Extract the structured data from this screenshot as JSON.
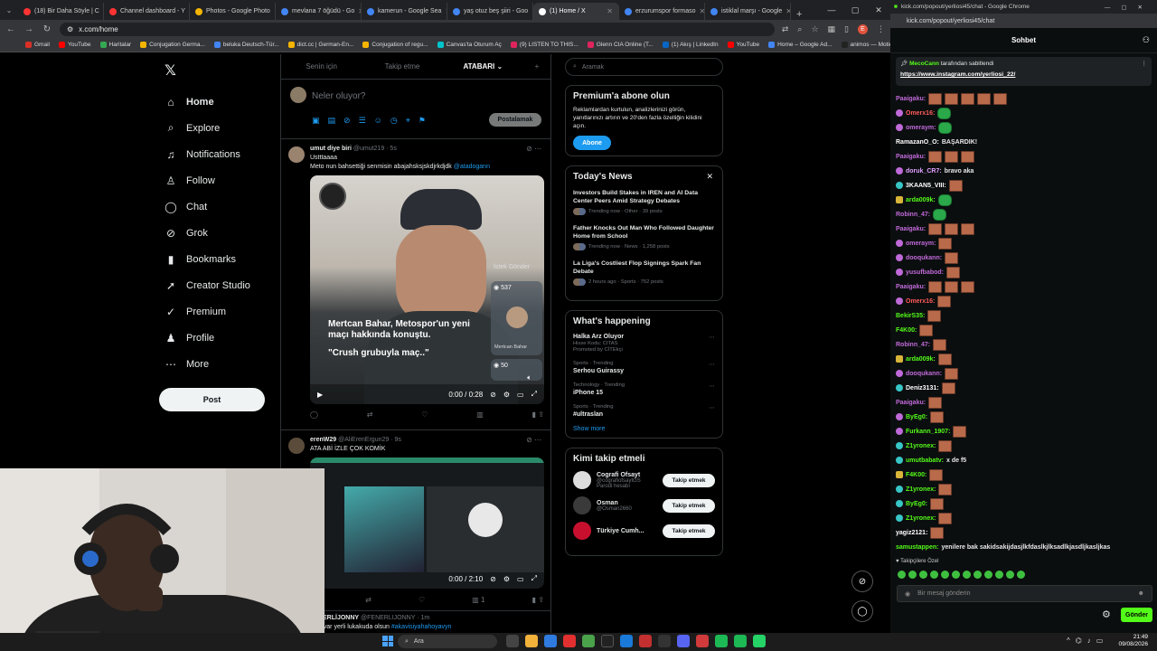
{
  "browser": {
    "tabs": [
      {
        "label": "(18) Bir Daha Söyle | C",
        "color": "#ff3333"
      },
      {
        "label": "Channel dashboard - Y",
        "color": "#ff3333"
      },
      {
        "label": "Photos - Google Photo",
        "color": "#f4b400"
      },
      {
        "label": "mevlana 7 öğüdü - Go",
        "color": "#4285f4"
      },
      {
        "label": "kamerun - Google Sea",
        "color": "#4285f4"
      },
      {
        "label": "yaş otuz beş şiiri - Goo",
        "color": "#4285f4"
      },
      {
        "label": "(1) Home / X",
        "color": "#ffffff"
      },
      {
        "label": "erzurumspor formaso",
        "color": "#4285f4"
      },
      {
        "label": "istiklal marşı - Google",
        "color": "#4285f4"
      }
    ],
    "url": "x.com/home",
    "bookmarks": [
      "Gmail",
      "YouTube",
      "Haritalar",
      "Conjugation Germa...",
      "beluka Deutsch-Tür...",
      "dict.cc | German-En...",
      "Conjugation of regu...",
      "Canvas'ta Oturum Aç",
      "(9) LISTEN TO THIS...",
      "Glenn CIA Online (T...",
      "(1) Akış | LinkedIn",
      "YouTube",
      "Home – Google Ad...",
      "animos — Motion t..."
    ]
  },
  "x": {
    "nav": [
      {
        "label": "Home",
        "icon": "home-icon",
        "glyph": "⌂",
        "bold": true
      },
      {
        "label": "Explore",
        "icon": "search-icon",
        "glyph": "⌕"
      },
      {
        "label": "Notifications",
        "icon": "bell-icon",
        "glyph": "♫"
      },
      {
        "label": "Follow",
        "icon": "person-add-icon",
        "glyph": "♙"
      },
      {
        "label": "Chat",
        "icon": "chat-icon",
        "glyph": "◯"
      },
      {
        "label": "Grok",
        "icon": "grok-icon",
        "glyph": "⊘"
      },
      {
        "label": "Bookmarks",
        "icon": "bookmark-icon",
        "glyph": "▮"
      },
      {
        "label": "Creator Studio",
        "icon": "rocket-icon",
        "glyph": "➚"
      },
      {
        "label": "Premium",
        "icon": "verified-icon",
        "glyph": "✓"
      },
      {
        "label": "Profile",
        "icon": "profile-icon",
        "glyph": "♟"
      },
      {
        "label": "More",
        "icon": "more-icon",
        "glyph": "⋯"
      }
    ],
    "post_label": "Post",
    "feed_tabs": [
      "Senin için",
      "Takip etme",
      "ATABARI ⌄"
    ],
    "compose_placeholder": "Neler oluyor?",
    "compose_post": "Postalamak",
    "tweets": [
      {
        "name": "umut diye biri",
        "handle": "@umut219 · 5s",
        "line1": "Ustttaaaa",
        "line2": "Meto nun bahsettiği senmisin abajahsksjskdjrkdjdk",
        "mention": "@atadogann",
        "caption1": "Mertcan Bahar, Metospor'un yeni",
        "caption2": "maçı hakkında konuştu.",
        "caption3": "\"Crush grubuyla maç..\"",
        "overlay": "İstek Gönder",
        "count1": "537",
        "overlay_name": "Mertcan Bahar",
        "count2": "50",
        "time": "0:00 / 0:28"
      },
      {
        "name": "erenW29",
        "handle": "@AliErenErgun29 · 9s",
        "line1": "ATA ABİ İZLE ÇOK KOMİK",
        "time": "0:00 / 2:10",
        "reply_count": "1"
      },
      {
        "name": "FENERLİJONNY",
        "handle": "@FENERLIJONNY · 1m",
        "line1": "posi var yerli lukakuda olsun",
        "mention": "#akavisiyahahoyavyn"
      }
    ],
    "search_placeholder": "Aramak",
    "premium": {
      "title": "Premium'a abone olun",
      "text": "Reklamlardan kurtulun, analizlerinizi görün, yanıtlarınızı artırın ve 20'den fazla özelliğin kilidini açın.",
      "button": "Abone"
    },
    "today_news": {
      "title": "Today's News",
      "items": [
        {
          "title": "Investors Build Stakes in IREN and AI Data Center Peers Amid Strategy Debates",
          "meta": "Trending now · Other · 39 posts"
        },
        {
          "title": "Father Knocks Out Man Who Followed Daughter Home from School",
          "meta": "Trending now · News · 1,258 posts"
        },
        {
          "title": "La Liga's Costliest Flop Signings Spark Fan Debate",
          "meta": "2 hours ago · Sports · 752 posts"
        }
      ]
    },
    "happening": {
      "title": "What's happening",
      "items": [
        {
          "category": "",
          "name": "Halka Arz Oluyor",
          "sub": "Hisse Kodu: CITAS",
          "sub2": "Promoted by CİTEkçi"
        },
        {
          "category": "Sports · Trending",
          "name": "Serhou Guirassy",
          "sub": "",
          "sub2": ""
        },
        {
          "category": "Technology · Trending",
          "name": "iPhone 15",
          "sub": "",
          "sub2": ""
        },
        {
          "category": "Sports · Trending",
          "name": "#ultraslan",
          "sub": "",
          "sub2": ""
        }
      ],
      "show_more": "Show more"
    },
    "who_to_follow": {
      "title": "Kimi takip etmeli",
      "items": [
        {
          "name": "Cografi Ofsayt",
          "handle": "@cografiofsaytGS",
          "note": "Parodi hesabı",
          "button": "Takip etmek",
          "color": "#dddddd"
        },
        {
          "name": "Osman",
          "handle": "@Osman2660",
          "note": "",
          "button": "Takip etmek",
          "color": "#3a3a3a"
        },
        {
          "name": "Türkiye Cumh...",
          "handle": "",
          "note": "",
          "button": "Takip etmek",
          "color": "#c8102e"
        }
      ]
    }
  },
  "chat": {
    "window_title": "kick.com/popout/yerliosi45/chat - Google Chrome",
    "url": "kick.com/popout/yerliosi45/chat",
    "header": "Sohbet",
    "pinned_by": "MecoCann",
    "pinned_suffix": "tarafından sabitlendi",
    "pinned_url": "https://www.instagram.com/yerliosi_22/",
    "messages": [
      {
        "user": "Paaigaku:",
        "color": "#c06ad9",
        "text": "",
        "emotes": 5,
        "green": 0,
        "badge": ""
      },
      {
        "user": "Omerx16:",
        "color": "#ff5a5a",
        "text": "",
        "emotes": 0,
        "green": 1,
        "badge": "p"
      },
      {
        "user": "omeraym:",
        "color": "#c06ad9",
        "text": "",
        "emotes": 0,
        "green": 1,
        "badge": "p"
      },
      {
        "user": "RamazanO_O:",
        "color": "#ffffff",
        "text": "BAŞARDIK!",
        "emotes": 0,
        "green": 0,
        "badge": ""
      },
      {
        "user": "Paaigaku:",
        "color": "#c06ad9",
        "text": "",
        "emotes": 3,
        "green": 0,
        "badge": ""
      },
      {
        "user": "doruk_CR7:",
        "color": "#e0a0ff",
        "text": "bravo aka",
        "emotes": 0,
        "green": 0,
        "badge": "p"
      },
      {
        "user": "3KAAN5_VIII:",
        "color": "#ffffff",
        "text": "",
        "emotes": 1,
        "green": 0,
        "badge": "g"
      },
      {
        "user": "arda009k:",
        "color": "#53fc18",
        "text": "",
        "emotes": 0,
        "green": 1,
        "badge": "y"
      },
      {
        "user": "Robinn_47:",
        "color": "#c06ad9",
        "text": "",
        "emotes": 0,
        "green": 1,
        "badge": ""
      },
      {
        "user": "Paaigaku:",
        "color": "#c06ad9",
        "text": "",
        "emotes": 3,
        "green": 0,
        "badge": ""
      },
      {
        "user": "omeraym:",
        "color": "#c06ad9",
        "text": "",
        "emotes": 1,
        "green": 0,
        "badge": "p"
      },
      {
        "user": "dooqukann:",
        "color": "#c06ad9",
        "text": "",
        "emotes": 1,
        "green": 0,
        "badge": "p"
      },
      {
        "user": "yusufbabod:",
        "color": "#c06ad9",
        "text": "",
        "emotes": 1,
        "green": 0,
        "badge": "p"
      },
      {
        "user": "Paaigaku:",
        "color": "#c06ad9",
        "text": "",
        "emotes": 3,
        "green": 0,
        "badge": ""
      },
      {
        "user": "Omerx16:",
        "color": "#ff5a5a",
        "text": "",
        "emotes": 1,
        "green": 0,
        "badge": "p"
      },
      {
        "user": "BekirS35:",
        "color": "#53fc18",
        "text": "",
        "emotes": 1,
        "green": 0,
        "badge": ""
      },
      {
        "user": "F4K00:",
        "color": "#53fc18",
        "text": "",
        "emotes": 1,
        "green": 0,
        "badge": ""
      },
      {
        "user": "Robinn_47:",
        "color": "#c06ad9",
        "text": "",
        "emotes": 1,
        "green": 0,
        "badge": ""
      },
      {
        "user": "arda009k:",
        "color": "#53fc18",
        "text": "",
        "emotes": 1,
        "green": 0,
        "badge": "y"
      },
      {
        "user": "dooqukann:",
        "color": "#c06ad9",
        "text": "",
        "emotes": 1,
        "green": 0,
        "badge": "p"
      },
      {
        "user": "Deniz3131:",
        "color": "#ffffff",
        "text": "",
        "emotes": 1,
        "green": 0,
        "badge": "g"
      },
      {
        "user": "Paaigaku:",
        "color": "#c06ad9",
        "text": "",
        "emotes": 1,
        "green": 0,
        "badge": ""
      },
      {
        "user": "ByEg0:",
        "color": "#53fc18",
        "text": "",
        "emotes": 1,
        "green": 0,
        "badge": "p"
      },
      {
        "user": "Furkann_1907:",
        "color": "#53fc18",
        "text": "",
        "emotes": 1,
        "green": 0,
        "badge": "p"
      },
      {
        "user": "Z1yronex:",
        "color": "#53fc18",
        "text": "",
        "emotes": 1,
        "green": 0,
        "badge": "g"
      },
      {
        "user": "umutbabatv:",
        "color": "#53fc18",
        "text": "x de f5",
        "emotes": 0,
        "green": 0,
        "badge": "g"
      },
      {
        "user": "F4K00:",
        "color": "#53fc18",
        "text": "",
        "emotes": 1,
        "green": 0,
        "badge": "y"
      },
      {
        "user": "Z1yronex:",
        "color": "#53fc18",
        "text": "",
        "emotes": 1,
        "green": 0,
        "badge": "g"
      },
      {
        "user": "ByEg0:",
        "color": "#53fc18",
        "text": "",
        "emotes": 1,
        "green": 0,
        "badge": "g"
      },
      {
        "user": "Z1yronex:",
        "color": "#53fc18",
        "text": "",
        "emotes": 1,
        "green": 0,
        "badge": "g"
      },
      {
        "user": "yagiz2121:",
        "color": "#ffffff",
        "text": "",
        "emotes": 1,
        "green": 0,
        "badge": ""
      },
      {
        "user": "samustappen:",
        "color": "#53fc18",
        "text": "yenilere bak sakidsakijdasjlkfdaslkjlksadlkjasdljkasljkas",
        "emotes": 0,
        "green": 0,
        "badge": ""
      }
    ],
    "followers_only": "Takipçilere Özel",
    "input_placeholder": "Bir mesaj gönderin",
    "send_label": "Gönder"
  },
  "taskbar": {
    "search": "Ara",
    "time": "21:49",
    "date": "09/08/2026"
  }
}
